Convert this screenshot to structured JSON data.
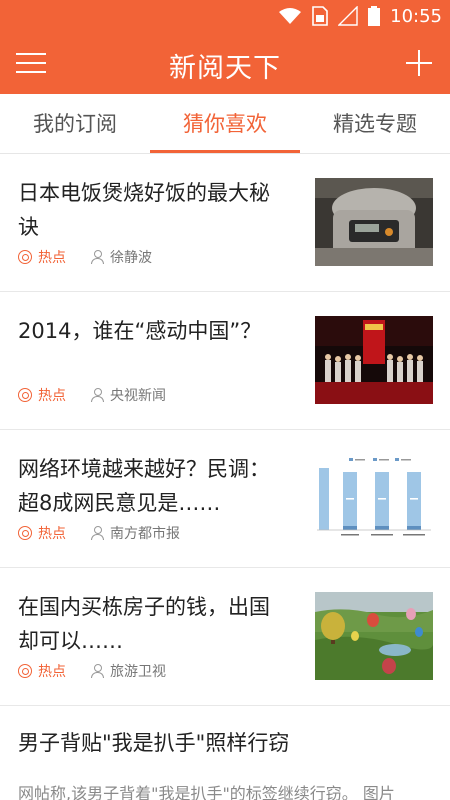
{
  "status_bar": {
    "time": "10:55",
    "icons": [
      "wifi-icon",
      "sim-card-icon",
      "signal-icon",
      "battery-icon"
    ]
  },
  "app_bar": {
    "title": "新阅天下",
    "left_icon": "menu-icon",
    "right_icon": "add-icon"
  },
  "tabs": [
    {
      "label": "我的订阅",
      "active": false
    },
    {
      "label": "猜你喜欢",
      "active": true
    },
    {
      "label": "精选专题",
      "active": false
    }
  ],
  "colors": {
    "accent": "#f26337",
    "text": "#222222",
    "muted": "#777777"
  },
  "feed": [
    {
      "title": "日本电饭煲烧好饭的最大秘诀",
      "tag": "热点",
      "source": "徐静波",
      "thumb": "rice-cooker-photo"
    },
    {
      "title": "2014，谁在“感动中国”？",
      "tag": "热点",
      "source": "央视新闻",
      "thumb": "stage-group-photo"
    },
    {
      "title": "网络环境越来越好？民调：超8成网民意见是……",
      "tag": "热点",
      "source": "南方都市报",
      "thumb": "survey-bar-chart"
    },
    {
      "title": "在国内买栋房子的钱，出国却可以……",
      "tag": "热点",
      "source": "旅游卫视",
      "thumb": "hot-air-balloons-photo"
    },
    {
      "title": "男子背贴\"我是扒手\"照样行窃",
      "summary": "网帖称,该男子背着\"我是扒手\"的标签继续行窃。 图片"
    }
  ]
}
